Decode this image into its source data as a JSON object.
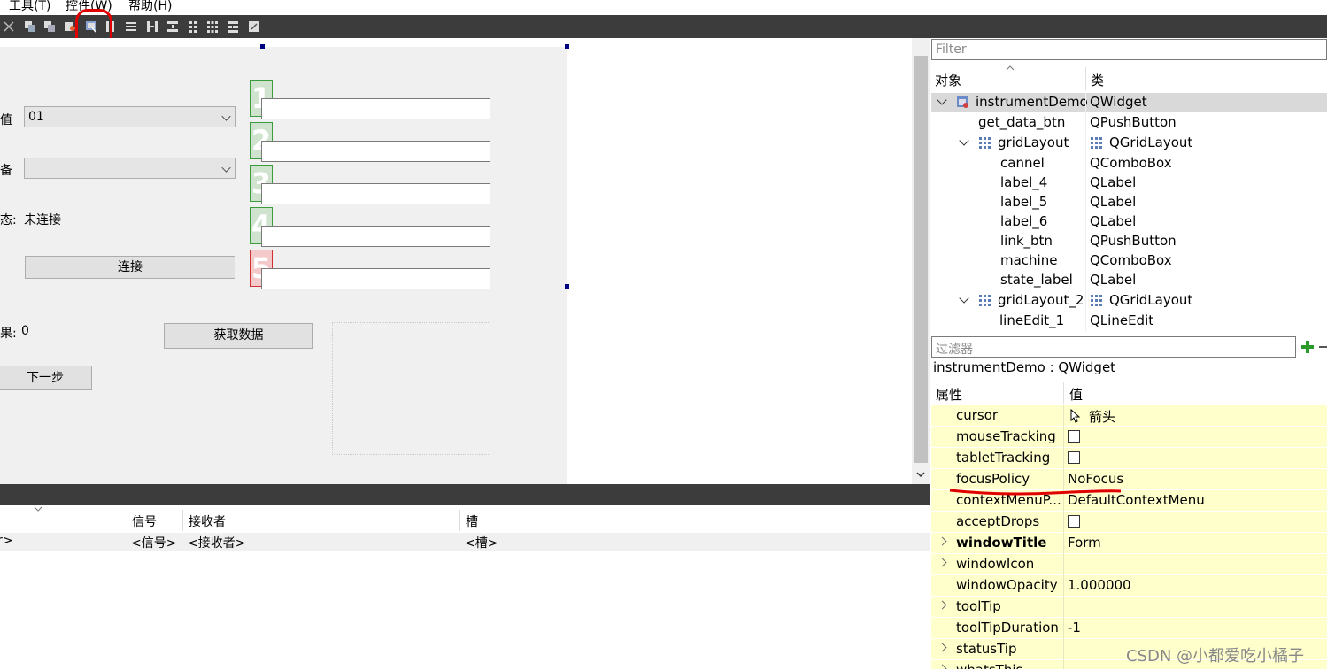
{
  "menubar": {
    "items": [
      "工具(T)",
      "控件(W)",
      "帮助(H)"
    ]
  },
  "toolbar": {
    "icons": [
      "close-icon",
      "widget-icon-1",
      "widget-icon-2",
      "edit-signals-icon",
      "edit-buddies-icon",
      "layout-horizontal-icon",
      "layout-vertical-icon",
      "layout-horiz-splitter-icon",
      "layout-vert-splitter-icon",
      "layout-grid-icon",
      "layout-grid-2-icon",
      "layout-form-icon",
      "adjust-size-icon"
    ]
  },
  "form": {
    "label_channel": "值",
    "combo_channel_value": "01",
    "label_machine": "备",
    "combo_machine_value": "",
    "label_state": "态:",
    "state_value": "未连接",
    "link_btn": "连接",
    "label_result": "果:",
    "result_value": "0",
    "get_data_btn": "获取数据",
    "next_btn": "下一步",
    "numbers": [
      "1",
      "2",
      "3",
      "4",
      "5"
    ]
  },
  "signal_slot": {
    "headers": {
      "sender": "",
      "signal": "信号",
      "receiver": "接收者",
      "slot": "槽"
    },
    "row": {
      "sender": "r>",
      "signal": "<信号>",
      "receiver": "<接收者>",
      "slot": "<槽>"
    }
  },
  "object_inspector": {
    "filter_placeholder": "Filter",
    "col_object": "对象",
    "col_class": "类",
    "rows": [
      {
        "name": "instrumentDemo",
        "cls": "QWidget"
      },
      {
        "name": "get_data_btn",
        "cls": "QPushButton"
      },
      {
        "name": "gridLayout",
        "cls": "QGridLayout"
      },
      {
        "name": "cannel",
        "cls": "QComboBox"
      },
      {
        "name": "label_4",
        "cls": "QLabel"
      },
      {
        "name": "label_5",
        "cls": "QLabel"
      },
      {
        "name": "label_6",
        "cls": "QLabel"
      },
      {
        "name": "link_btn",
        "cls": "QPushButton"
      },
      {
        "name": "machine",
        "cls": "QComboBox"
      },
      {
        "name": "state_label",
        "cls": "QLabel"
      },
      {
        "name": "gridLayout_2",
        "cls": "QGridLayout"
      },
      {
        "name": "lineEdit_1",
        "cls": "QLineEdit"
      }
    ]
  },
  "property_editor": {
    "filter_placeholder": "过滤器",
    "title": "instrumentDemo : QWidget",
    "col_prop": "属性",
    "col_value": "值",
    "rows": [
      {
        "name": "cursor",
        "value": "箭头"
      },
      {
        "name": "mouseTracking",
        "value": ""
      },
      {
        "name": "tabletTracking",
        "value": ""
      },
      {
        "name": "focusPolicy",
        "value": "NoFocus"
      },
      {
        "name": "contextMenuP...",
        "value": "DefaultContextMenu"
      },
      {
        "name": "acceptDrops",
        "value": ""
      },
      {
        "name": "windowTitle",
        "value": "Form"
      },
      {
        "name": "windowIcon",
        "value": ""
      },
      {
        "name": "windowOpacity",
        "value": "1.000000"
      },
      {
        "name": "toolTip",
        "value": ""
      },
      {
        "name": "toolTipDuration",
        "value": "-1"
      },
      {
        "name": "statusTip",
        "value": ""
      },
      {
        "name": "whatsThis",
        "value": ""
      }
    ]
  },
  "watermark": "CSDN @小都爱吃小橘子",
  "colors": {
    "annotation_red": "#e00000",
    "property_bg": "#ffffcc",
    "toolbar_bg": "#3c3c3c"
  }
}
